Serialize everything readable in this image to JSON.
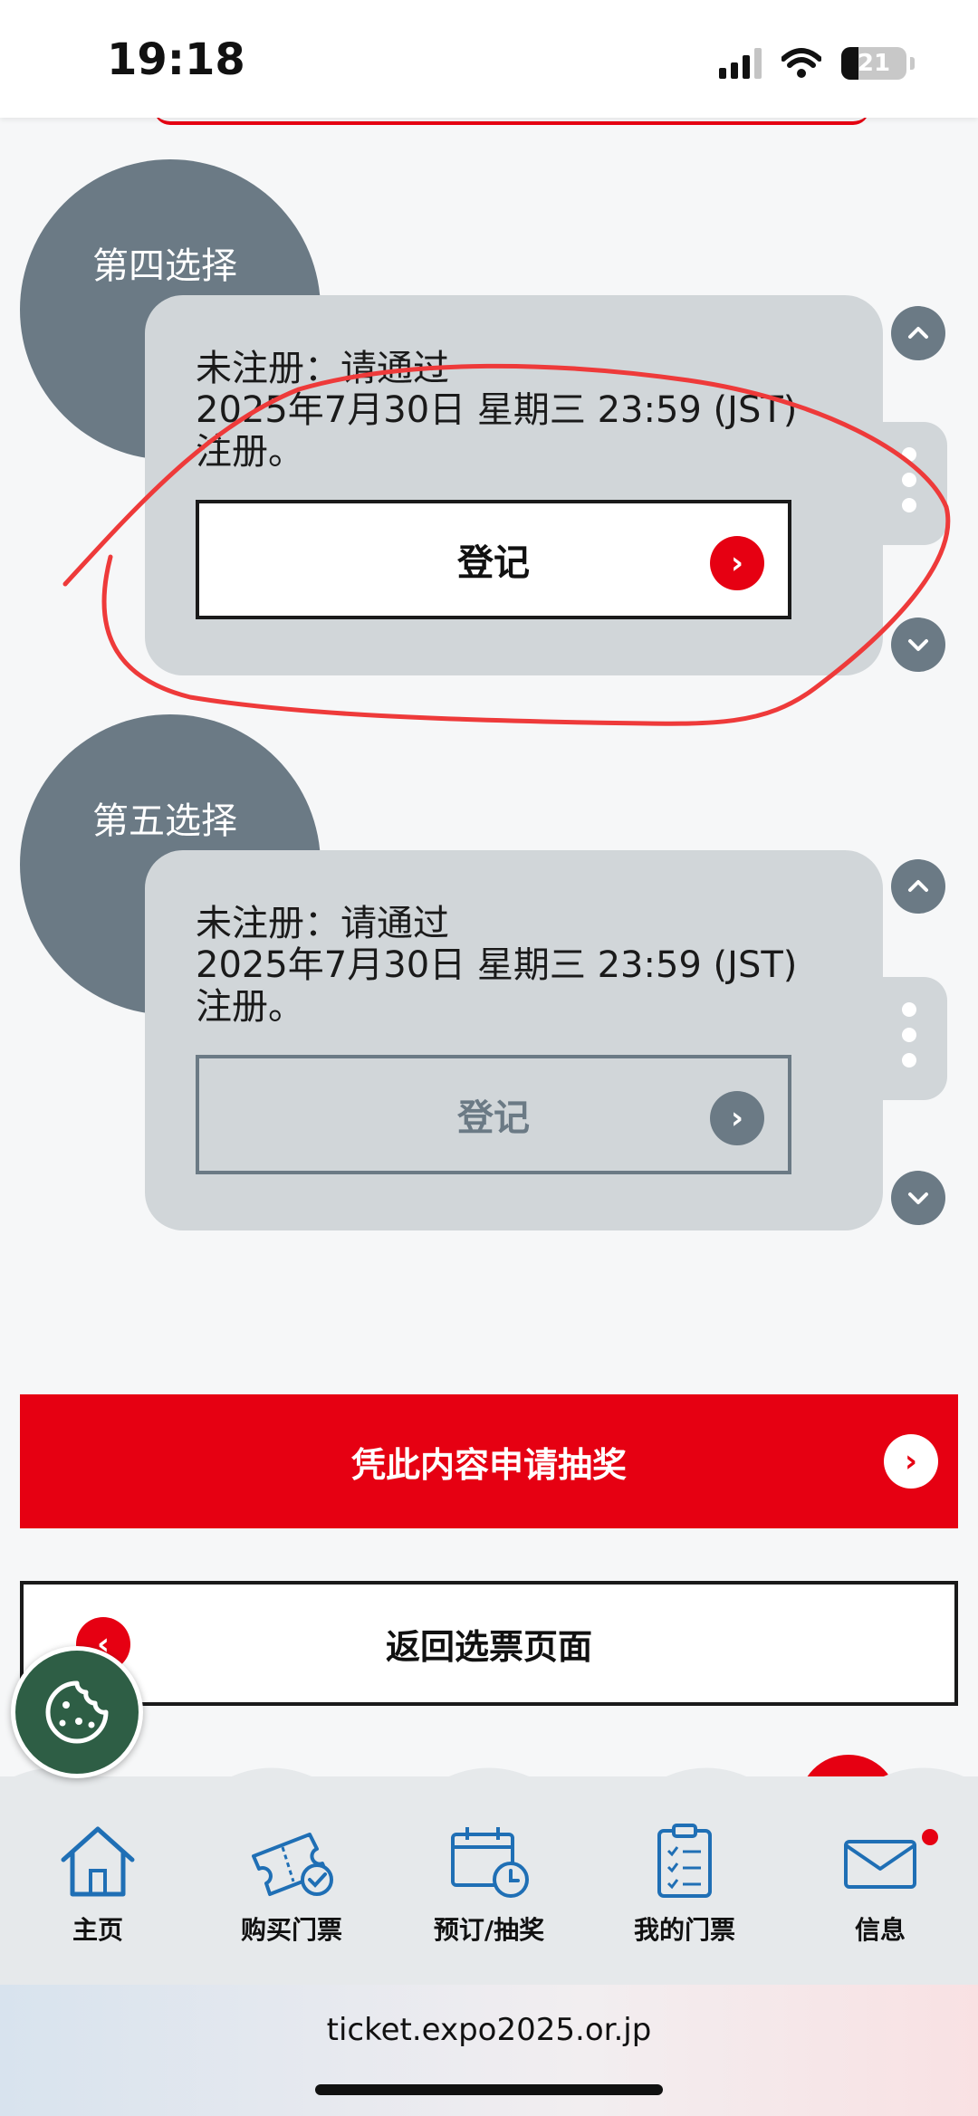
{
  "status_bar": {
    "time": "19:18",
    "battery": "21"
  },
  "choices": [
    {
      "title": "第四选择",
      "text_line1": "未注册：请通过",
      "text_line2": "2025年7月30日 星期三 23:59 (JST)",
      "text_line3": "注册。",
      "button_label": "登记",
      "enabled": true
    },
    {
      "title": "第五选择",
      "text_line1": "未注册：请通过",
      "text_line2": "2025年7月30日 星期三 23:59 (JST)",
      "text_line3": "注册。",
      "button_label": "登记",
      "enabled": false
    }
  ],
  "actions": {
    "apply_label": "凭此内容申请抽奖",
    "back_label": "返回选票页面"
  },
  "bottom_nav": {
    "items": [
      {
        "label": "主页",
        "icon": "home-icon"
      },
      {
        "label": "购买门票",
        "icon": "ticket-check-icon"
      },
      {
        "label": "预订/抽奖",
        "icon": "calendar-clock-icon"
      },
      {
        "label": "我的门票",
        "icon": "clipboard-list-icon"
      },
      {
        "label": "信息",
        "icon": "mail-icon"
      }
    ]
  },
  "browser": {
    "url": "ticket.expo2025.or.jp"
  },
  "colors": {
    "accent": "#e60012",
    "slate": "#6b7a85",
    "card": "#d1d6d9",
    "nav_icon": "#1f6fb5"
  }
}
